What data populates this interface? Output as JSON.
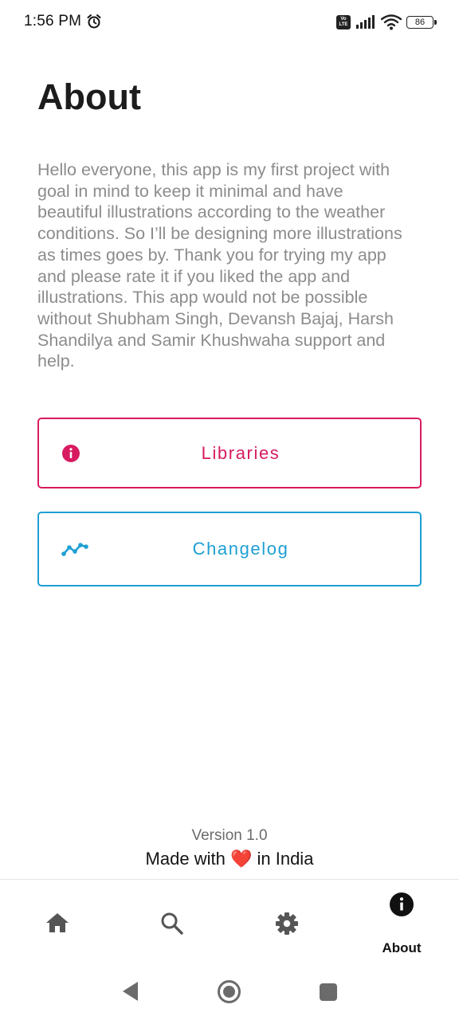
{
  "status_bar": {
    "time": "1:56 PM",
    "volte_top": "Vo",
    "volte_bottom": "LTE",
    "battery": "86",
    "icons": [
      "alarm-icon",
      "volte-icon",
      "signal-icon",
      "wifi-icon",
      "battery-icon"
    ]
  },
  "page": {
    "title": "About",
    "body": "Hello everyone, this app is my first project with goal in mind to keep it minimal and have beautiful illustrations according to the weather conditions. So I’ll be designing more illustrations as times goes by. Thank you for trying my app and please rate it if you liked the app and illustrations. This app would not be possible without Shubham Singh, Devansh Bajaj, Harsh Shandilya and Samir Khushwaha support and help."
  },
  "buttons": {
    "libraries": {
      "label": "Libraries",
      "icon": "info-icon",
      "color": "#d81b60"
    },
    "changelog": {
      "label": "Changelog",
      "icon": "trending-line-icon",
      "color": "#1e9fd4"
    }
  },
  "footer": {
    "version": "Version 1.0",
    "made_prefix": "Made with",
    "heart": "❤️",
    "made_suffix": "in India"
  },
  "bottom_nav": {
    "items": [
      {
        "id": "home",
        "icon": "home-icon"
      },
      {
        "id": "search",
        "icon": "search-icon"
      },
      {
        "id": "settings",
        "icon": "gear-icon"
      },
      {
        "id": "about",
        "icon": "info-icon",
        "label": "About",
        "active": true
      }
    ]
  },
  "system_nav": {
    "icons": [
      "back-icon",
      "home-circle-icon",
      "recents-icon"
    ]
  }
}
